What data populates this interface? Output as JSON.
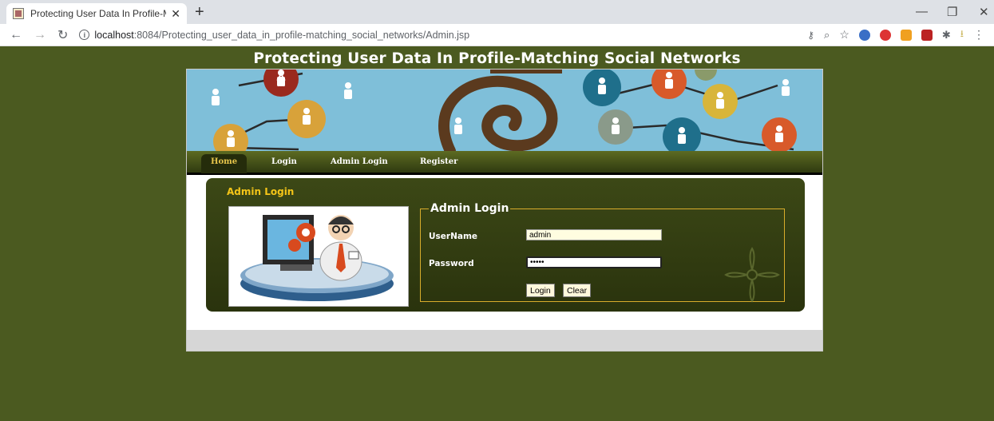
{
  "browser": {
    "tab_title": "Protecting User Data In Profile-M",
    "url_host": "localhost",
    "url_rest": ":8084/Protecting_user_data_in_profile-matching_social_networks/Admin.jsp"
  },
  "site": {
    "title": "Protecting User Data In Profile-Matching Social Networks",
    "nav": [
      "Home",
      "Login",
      "Admin Login",
      "Register"
    ]
  },
  "panel": {
    "heading": "Admin Login",
    "form_legend": "Admin Login",
    "username_label": "UserName",
    "username_value": "admin",
    "password_label": "Password",
    "password_value": "•••••",
    "login_button": "Login",
    "clear_button": "Clear"
  },
  "colors": {
    "page_bg": "#4b5a20",
    "accent": "#f5c518",
    "banner_bg": "#7fbfd9"
  }
}
